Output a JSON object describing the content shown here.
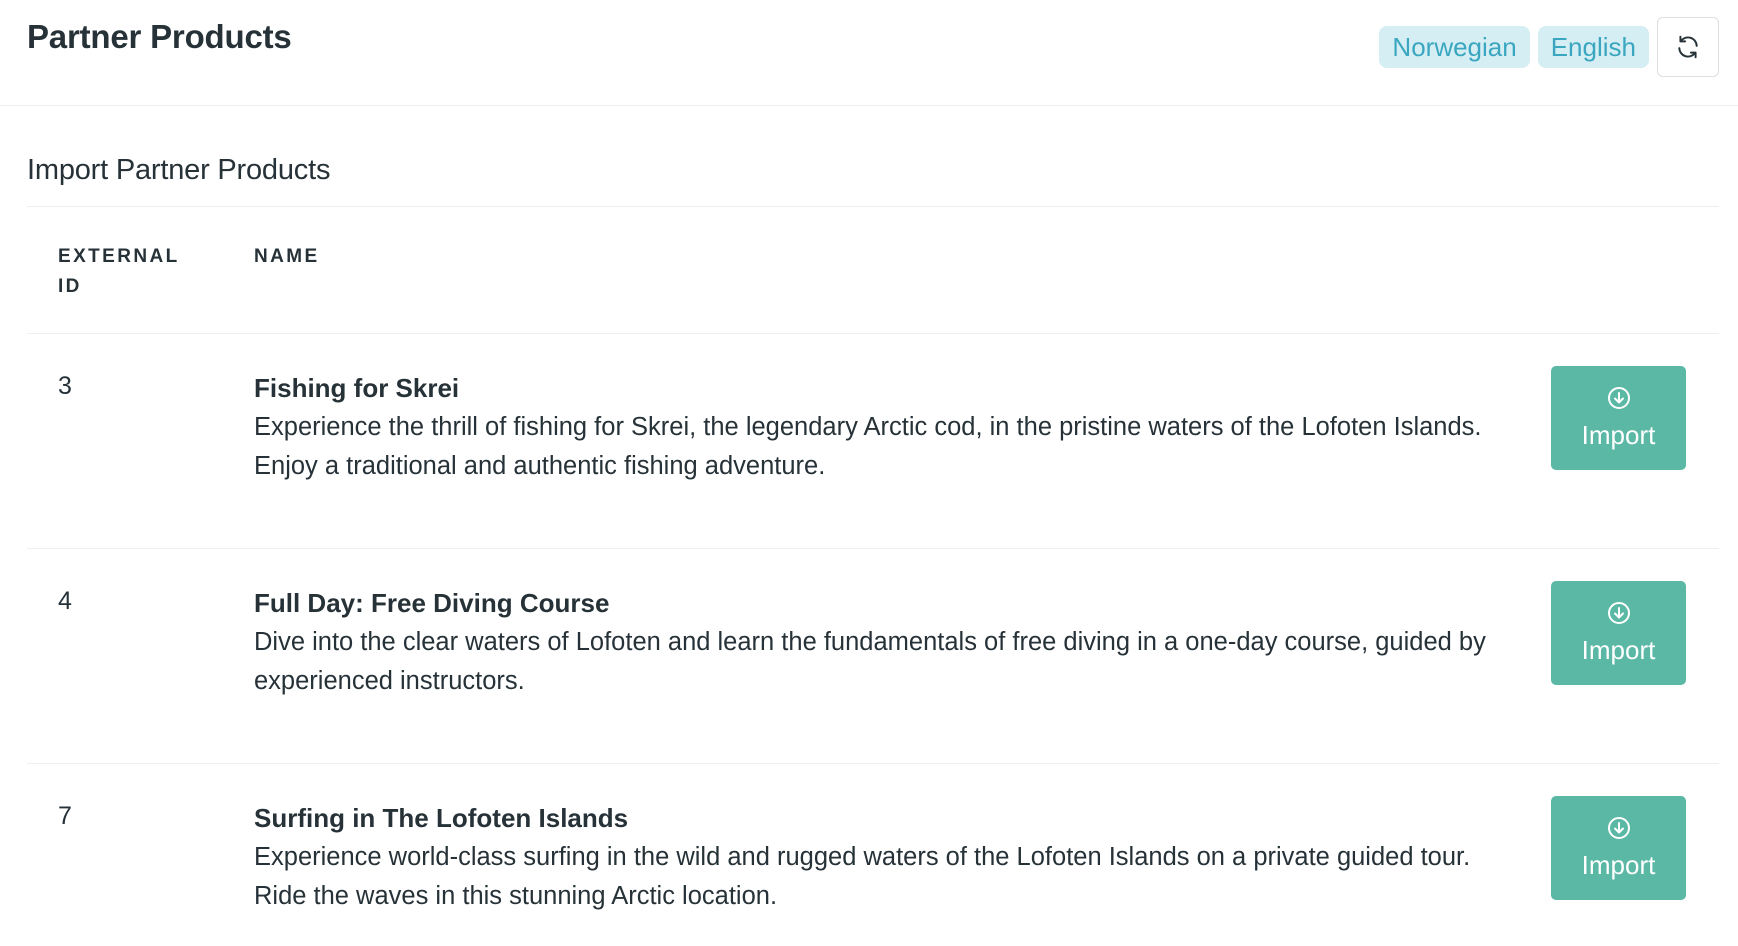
{
  "header": {
    "title": "Partner Products",
    "languages": [
      "Norwegian",
      "English"
    ],
    "refresh_icon": "refresh-icon"
  },
  "section": {
    "title": "Import Partner Products"
  },
  "table": {
    "columns": {
      "external_id": "EXTERNAL ID",
      "name": "NAME"
    },
    "rows": [
      {
        "id": "3",
        "title": "Fishing for Skrei",
        "description": "Experience the thrill of fishing for Skrei, the legendary Arctic cod, in the pristine waters of the Lofoten Islands. Enjoy a traditional and authentic fishing adventure.",
        "action_label": "Import",
        "action_icon": "download-circle-icon"
      },
      {
        "id": "4",
        "title": "Full Day: Free Diving Course",
        "description": "Dive into the clear waters of Lofoten and learn the fundamentals of free diving in a one-day course, guided by experienced instructors.",
        "action_label": "Import",
        "action_icon": "download-circle-icon"
      },
      {
        "id": "7",
        "title": "Surfing in The Lofoten Islands",
        "description": "Experience world-class surfing in the wild and rugged waters of the Lofoten Islands on a private guided tour. Ride the waves in this stunning Arctic location.",
        "action_label": "Import",
        "action_icon": "download-circle-icon"
      }
    ]
  },
  "colors": {
    "accent": "#5ab8a5",
    "badge_bg": "#d4eef3",
    "badge_text": "#3aa6c0",
    "text": "#263238",
    "divider": "#eceff1"
  }
}
